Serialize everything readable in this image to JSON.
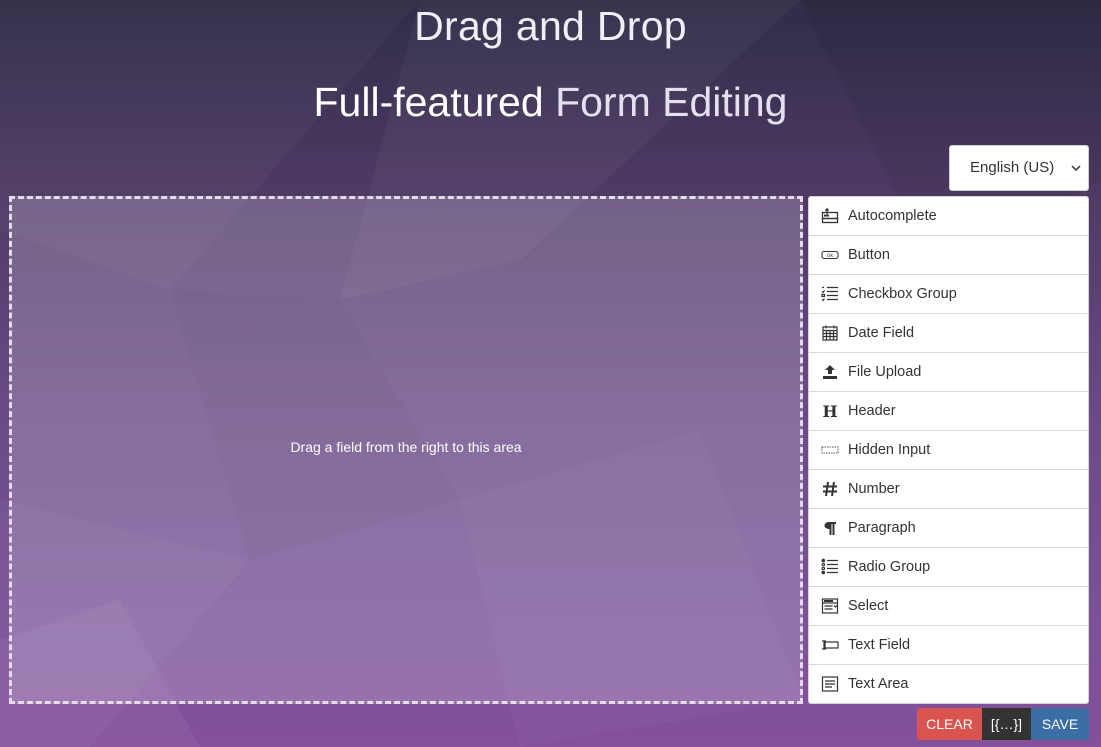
{
  "header": {
    "title": "Drag and Drop",
    "subtitle_strong": "Full-featured",
    "subtitle_light": "Form Editing"
  },
  "language": {
    "selected": "English (US)"
  },
  "stage": {
    "hint": "Drag a field from the right to this area"
  },
  "controls": [
    {
      "label": "Autocomplete",
      "icon": "autocomplete-icon"
    },
    {
      "label": "Button",
      "icon": "button-icon"
    },
    {
      "label": "Checkbox Group",
      "icon": "checkbox-group-icon"
    },
    {
      "label": "Date Field",
      "icon": "calendar-icon"
    },
    {
      "label": "File Upload",
      "icon": "upload-icon"
    },
    {
      "label": "Header",
      "icon": "header-icon"
    },
    {
      "label": "Hidden Input",
      "icon": "hidden-input-icon"
    },
    {
      "label": "Number",
      "icon": "hash-icon"
    },
    {
      "label": "Paragraph",
      "icon": "pilcrow-icon"
    },
    {
      "label": "Radio Group",
      "icon": "radio-group-icon"
    },
    {
      "label": "Select",
      "icon": "select-icon"
    },
    {
      "label": "Text Field",
      "icon": "text-field-icon"
    },
    {
      "label": "Text Area",
      "icon": "textarea-icon"
    }
  ],
  "actions": {
    "clear": "Clear",
    "json": "[{…}]",
    "save": "Save"
  },
  "colors": {
    "clear": "#d9534f",
    "json": "#333333",
    "save": "#3a6ea5"
  }
}
